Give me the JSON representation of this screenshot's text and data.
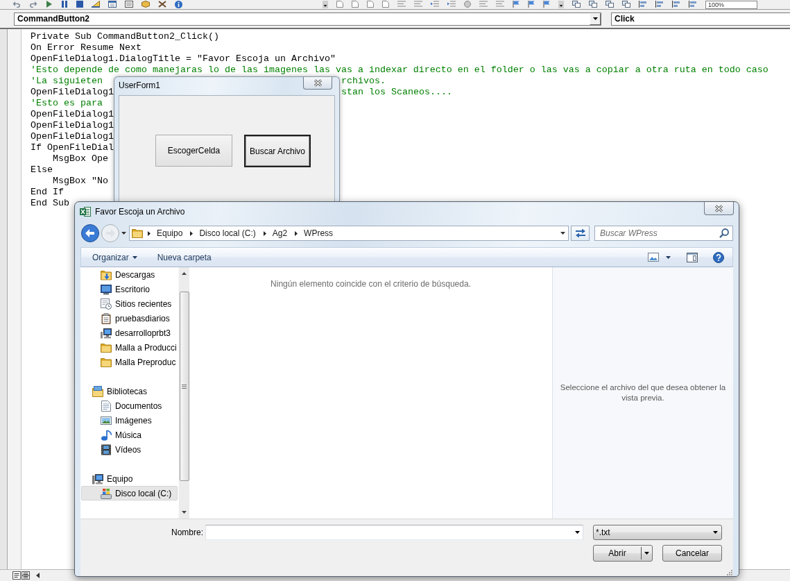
{
  "toolbar": {
    "zoom": "100%"
  },
  "object_combo": {
    "value": "CommandButton2"
  },
  "procedure_combo": {
    "value": "Click"
  },
  "code_lines": [
    {
      "kind": "code",
      "text": "Private Sub CommandButton2_Click()"
    },
    {
      "kind": "code",
      "text": "On Error Resume Next"
    },
    {
      "kind": "code",
      "text": "OpenFileDialog1.DialogTitle = \"Favor Escoja un Archivo\""
    },
    {
      "kind": "comment",
      "text": "'Esto depende de como manejaras lo de las imagenes las vas a indexar directo en el folder o las vas a copiar a otra ruta en todo caso"
    },
    {
      "kind": "comment",
      "text": "'La siguieten",
      "after": {
        "kind": "comment",
        "text": "rchivos."
      }
    },
    {
      "kind": "code",
      "text": "OpenFileDialog1",
      "after": {
        "kind": "comment",
        "text": "stan los Scaneos...."
      }
    },
    {
      "kind": "comment",
      "text": "'Esto es para"
    },
    {
      "kind": "code",
      "text": "OpenFileDialog1"
    },
    {
      "kind": "code",
      "text": "OpenFileDialog1"
    },
    {
      "kind": "code",
      "text": "OpenFileDialog1"
    },
    {
      "kind": "code",
      "text": "If OpenFileDial"
    },
    {
      "kind": "code",
      "text": "    MsgBox Ope"
    },
    {
      "kind": "code",
      "text": "Else"
    },
    {
      "kind": "code",
      "text": "    MsgBox \"No"
    },
    {
      "kind": "code",
      "text": "End If"
    },
    {
      "kind": "code",
      "text": "End Sub"
    }
  ],
  "userform": {
    "title": "UserForm1",
    "buttons": [
      {
        "label": "EscogerCelda",
        "focused": false
      },
      {
        "label": "Buscar Archivo",
        "focused": true
      }
    ]
  },
  "file_dialog": {
    "title": "Favor Escoja un Archivo",
    "nav_buttons": [
      {
        "kind": "back",
        "disabled": false
      },
      {
        "kind": "forward",
        "disabled": true
      }
    ],
    "breadcrumbs": [
      "Equipo",
      "Disco local (C:)",
      "Ag2",
      "WPress"
    ],
    "search": {
      "placeholder": "Buscar WPress"
    },
    "commands": [
      {
        "label": "Organizar",
        "menu": true
      },
      {
        "label": "Nueva carpeta",
        "menu": false
      }
    ],
    "nav_tree": [
      {
        "children": [
          {
            "kind": "downloads",
            "label": "Descargas",
            "selected": false
          },
          {
            "kind": "desktop",
            "label": "Escritorio",
            "selected": false
          },
          {
            "kind": "recent",
            "label": "Sitios recientes",
            "selected": false
          },
          {
            "kind": "clipboard",
            "label": "pruebasdiarios",
            "selected": false
          },
          {
            "kind": "network",
            "label": "desarrolloprbt3",
            "selected": false
          },
          {
            "kind": "folder",
            "label": "Malla a Producci",
            "selected": false
          },
          {
            "kind": "folder",
            "label": "Malla Preproduc",
            "selected": false
          }
        ]
      },
      {
        "kind": "library",
        "label": "Bibliotecas",
        "selected": false,
        "children": [
          {
            "kind": "documents",
            "label": "Documentos",
            "selected": false
          },
          {
            "kind": "pictures",
            "label": "Imágenes",
            "selected": false
          },
          {
            "kind": "music",
            "label": "Música",
            "selected": false
          },
          {
            "kind": "videos",
            "label": "Vídeos",
            "selected": false
          }
        ]
      },
      {
        "kind": "computer",
        "label": "Equipo",
        "selected": false,
        "children": [
          {
            "kind": "drive",
            "label": "Disco local (C:)",
            "selected": true
          }
        ]
      }
    ],
    "empty_message": "Ningún elemento coincide con el criterio de búsqueda.",
    "preview_message": "Seleccione el archivo del que desea obtener la vista previa.",
    "filename_label": "Nombre:",
    "file_type": "*.txt",
    "buttons": [
      {
        "kind": "split",
        "label": "Abrir"
      },
      {
        "kind": "plain",
        "label": "Cancelar"
      }
    ]
  }
}
